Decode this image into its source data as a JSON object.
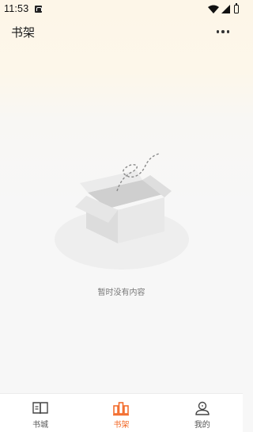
{
  "status_bar": {
    "time": "11:53",
    "icons": [
      "notification-icon",
      "wifi-icon",
      "signal-icon",
      "battery-icon"
    ]
  },
  "header": {
    "title": "书架",
    "more_icon": "more-icon"
  },
  "empty_state": {
    "illustration": "empty-box-icon",
    "message": "暂时没有内容"
  },
  "tab_bar": {
    "items": [
      {
        "label": "书城",
        "icon": "book-open-icon",
        "active": false
      },
      {
        "label": "书架",
        "icon": "bookshelf-icon",
        "active": true
      },
      {
        "label": "我的",
        "icon": "user-icon",
        "active": false
      }
    ]
  },
  "colors": {
    "accent": "#f26522",
    "header_bg": "#fdf6e8",
    "page_bg": "#f7f7f7"
  }
}
